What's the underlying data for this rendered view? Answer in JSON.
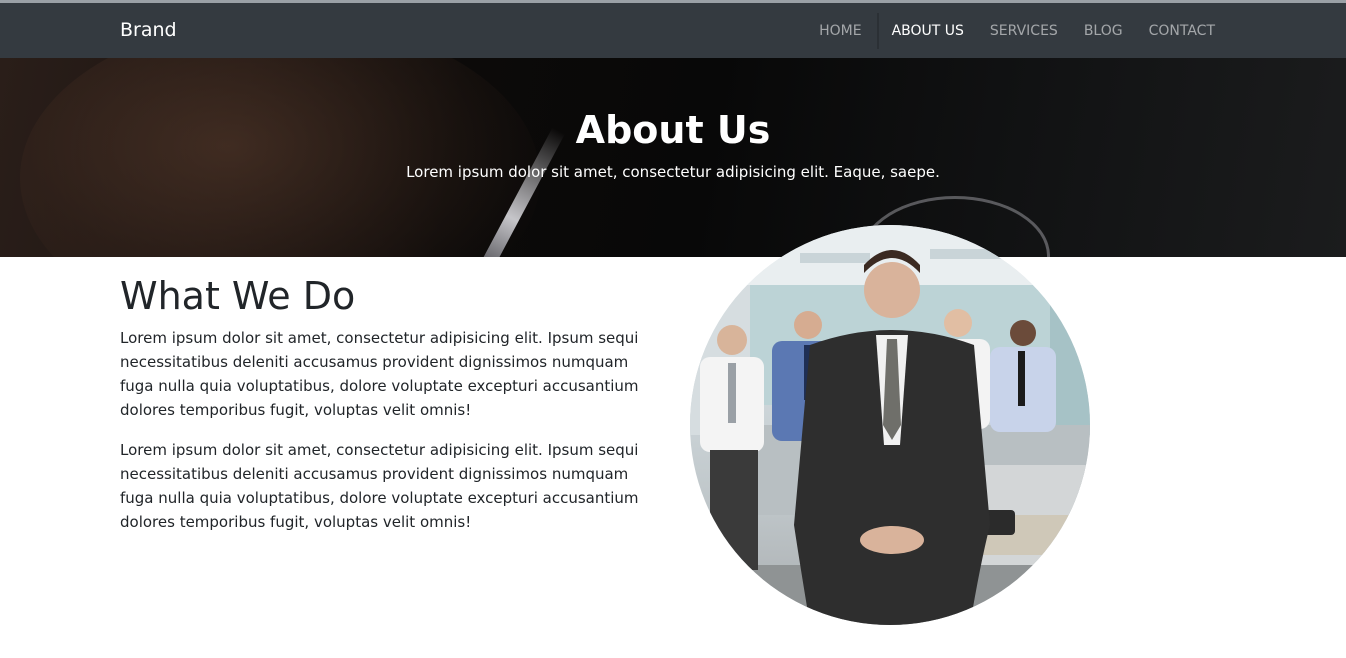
{
  "navbar": {
    "brand": "Brand",
    "items": [
      {
        "label": "HOME"
      },
      {
        "label": "ABOUT US",
        "active": true
      },
      {
        "label": "SERVICES"
      },
      {
        "label": "BLOG"
      },
      {
        "label": "CONTACT"
      }
    ]
  },
  "hero": {
    "title": "About Us",
    "subtitle": "Lorem ipsum dolor sit amet, consectetur adipisicing elit. Eaque, saepe."
  },
  "content": {
    "heading": "What We Do",
    "paragraphs": [
      "Lorem ipsum dolor sit amet, consectetur adipisicing elit. Ipsum sequi necessitatibus deleniti accusamus provident dignissimos numquam fuga nulla quia voluptatibus, dolore voluptate excepturi accusantium dolores temporibus fugit, voluptas velit omnis!",
      "Lorem ipsum dolor sit amet, consectetur adipisicing elit. Ipsum sequi necessitatibus deleniti accusamus provident dignissimos numquam fuga nulla quia voluptatibus, dolore voluptate excepturi accusantium dolores temporibus fugit, voluptas velit omnis!"
    ]
  },
  "colors": {
    "navbar_bg": "#343a40",
    "text": "#212529",
    "hero_text": "#ffffff"
  }
}
